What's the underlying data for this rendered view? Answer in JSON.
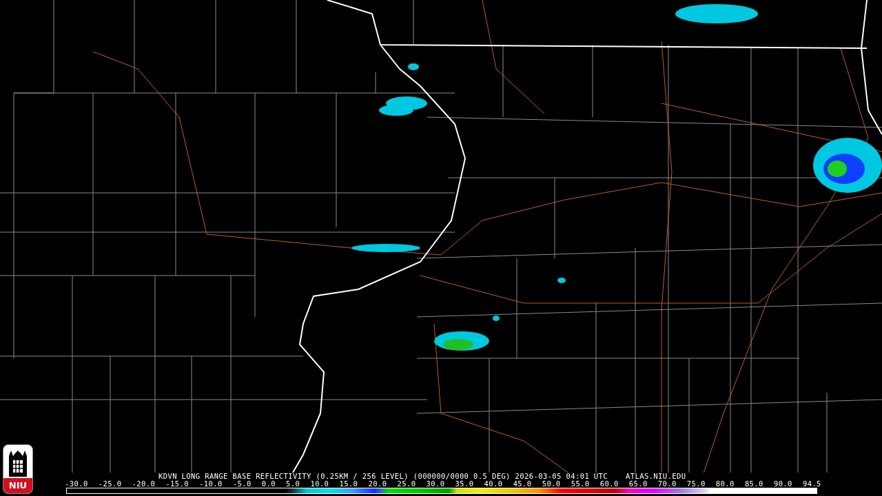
{
  "logo": {
    "text": "NIU"
  },
  "product": {
    "title": "KDVN LONG RANGE BASE REFLECTIVITY (0.25KM / 256 LEVEL) (000000/0000 0.5 DEG) 2026-03-05 04:01 UTC",
    "source": "ATLAS.NIU.EDU"
  },
  "scale": {
    "labels": [
      "-30.0",
      "-25.0",
      "-20.0",
      "-15.0",
      "-10.0",
      "-5.0",
      "0.0",
      "5.0",
      "10.0",
      "15.0",
      "20.0",
      "25.0",
      "30.0",
      "35.0",
      "40.0",
      "45.0",
      "50.0",
      "55.0",
      "60.0",
      "65.0",
      "70.0",
      "75.0",
      "80.0",
      "85.0",
      "90.0",
      "94.5"
    ]
  }
}
